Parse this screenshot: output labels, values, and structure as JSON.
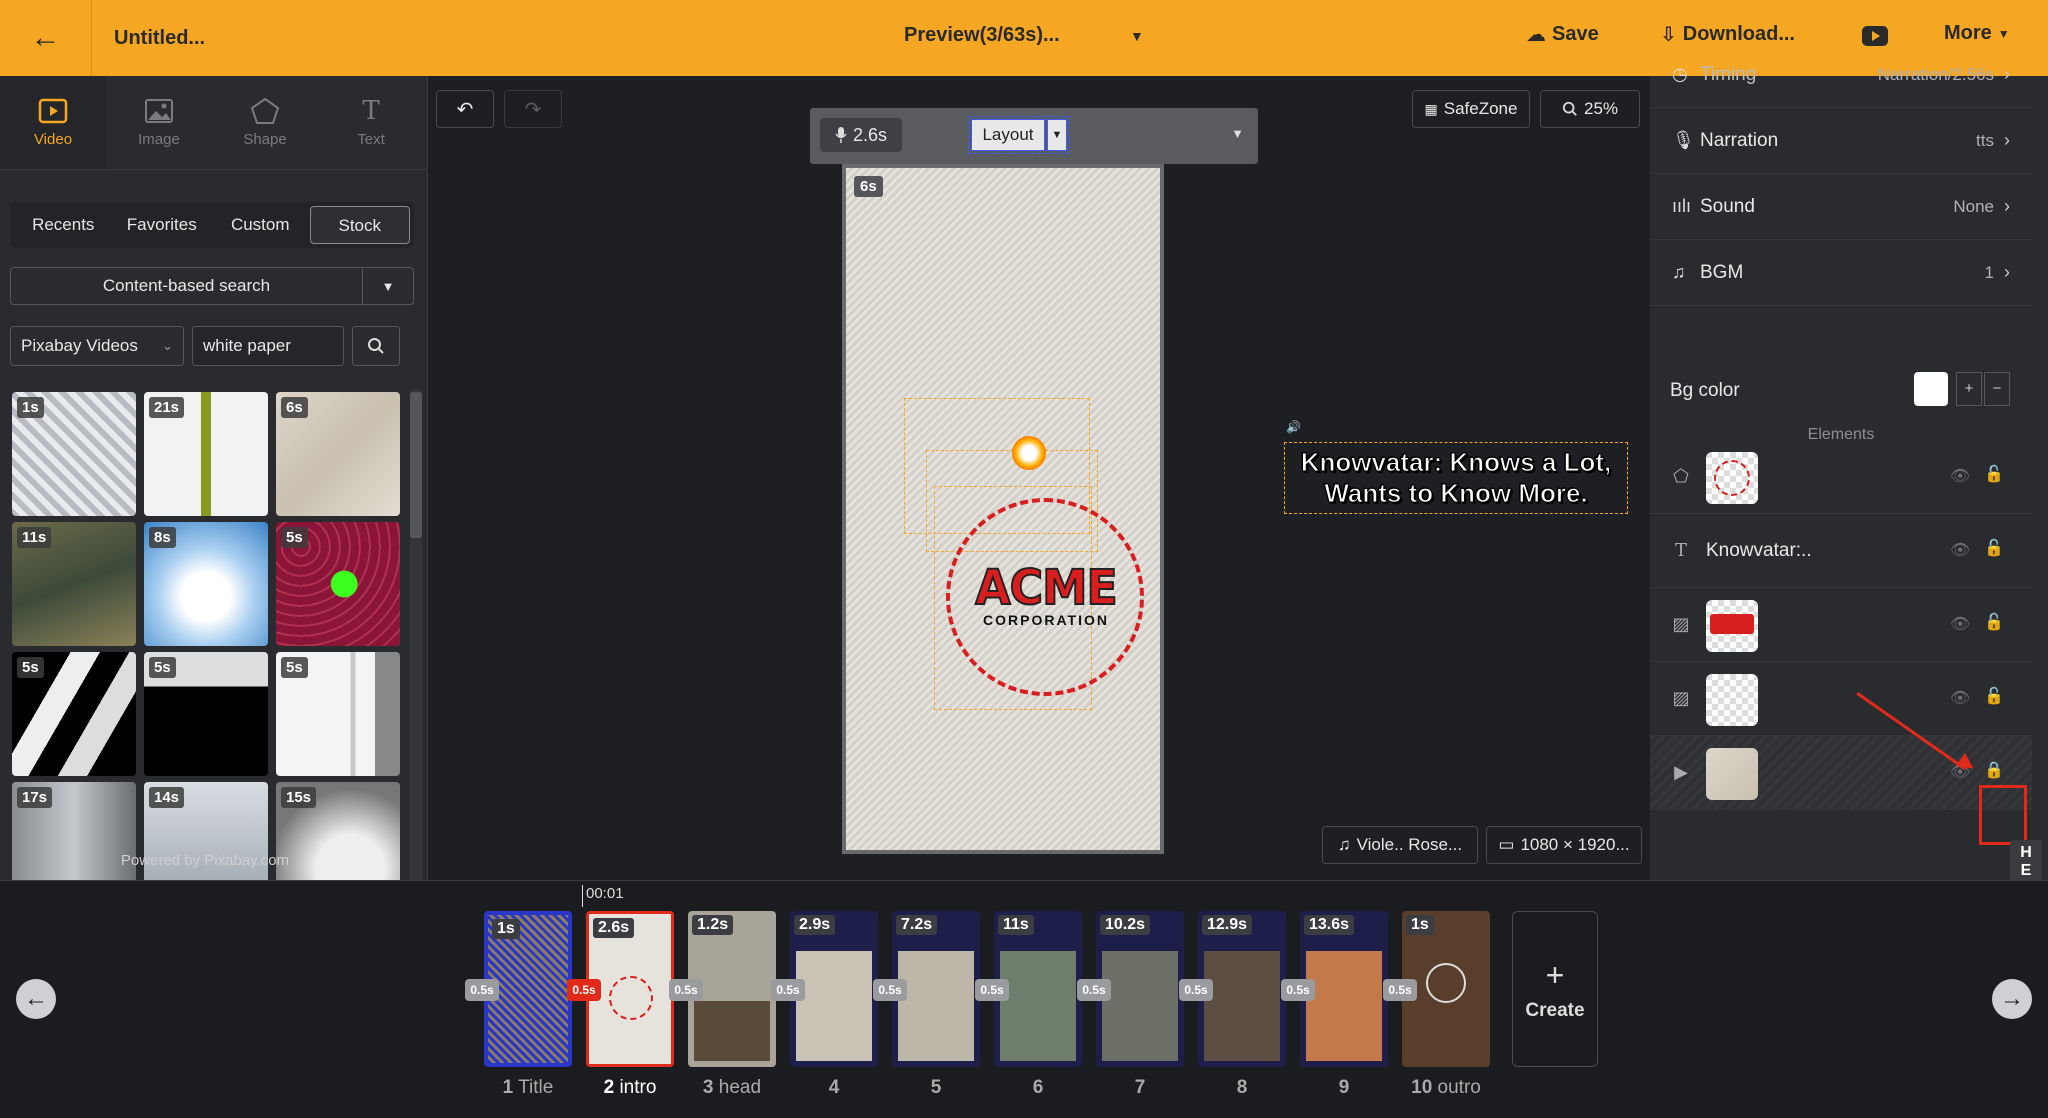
{
  "topbar": {
    "title": "Untitled...",
    "preview": "Preview(3/63s)...",
    "save": "Save",
    "download": "Download...",
    "more": "More"
  },
  "left": {
    "modes": [
      "Video",
      "Image",
      "Shape",
      "Text"
    ],
    "subtabs": [
      "Recents",
      "Favorites",
      "Custom",
      "Stock"
    ],
    "content_search": "Content-based search",
    "source": "Pixabay Videos",
    "query": "white paper",
    "thumb_durations": [
      "1s",
      "21s",
      "6s",
      "11s",
      "8s",
      "5s",
      "5s",
      "5s",
      "5s",
      "17s",
      "14s",
      "15s"
    ],
    "powered": "Powered by Pixabay.com"
  },
  "canvas": {
    "duration": "2.6s",
    "layout": "Layout",
    "safezone": "SafeZone",
    "zoom": "25%",
    "scene_duration": "6s",
    "logo_top": "ACME",
    "logo_bottom": "CORPORATION",
    "caption_line1": "Knowvatar: Knows a Lot,",
    "caption_line2": "Wants to Know More.",
    "music": "Viole.. Rose...",
    "resolution": "1080 × 1920..."
  },
  "right": {
    "timing": "Timing",
    "timing_value": "Narration/2.56s",
    "narration": "Narration",
    "narration_value": "tts",
    "sound": "Sound",
    "sound_value": "None",
    "bgm": "BGM",
    "bgm_value": "1",
    "bgcolor": "Bg color",
    "bgcolor_value": "#ffffff",
    "elements_header": "Elements",
    "text_element": "Knowvatar:.."
  },
  "timeline": {
    "time_marker": "00:01",
    "scenes": [
      {
        "dur": "1s",
        "label_num": "1",
        "label": "Title"
      },
      {
        "dur": "2.6s",
        "label_num": "2",
        "label": "intro"
      },
      {
        "dur": "1.2s",
        "label_num": "3",
        "label": "head"
      },
      {
        "dur": "2.9s",
        "label_num": "4",
        "label": ""
      },
      {
        "dur": "7.2s",
        "label_num": "5",
        "label": ""
      },
      {
        "dur": "11s",
        "label_num": "6",
        "label": ""
      },
      {
        "dur": "10.2s",
        "label_num": "7",
        "label": ""
      },
      {
        "dur": "12.9s",
        "label_num": "8",
        "label": ""
      },
      {
        "dur": "13.6s",
        "label_num": "9",
        "label": ""
      },
      {
        "dur": "1s",
        "label_num": "10",
        "label": "outro"
      }
    ],
    "transition": "0.5s",
    "create": "Create"
  },
  "help": "HELP"
}
